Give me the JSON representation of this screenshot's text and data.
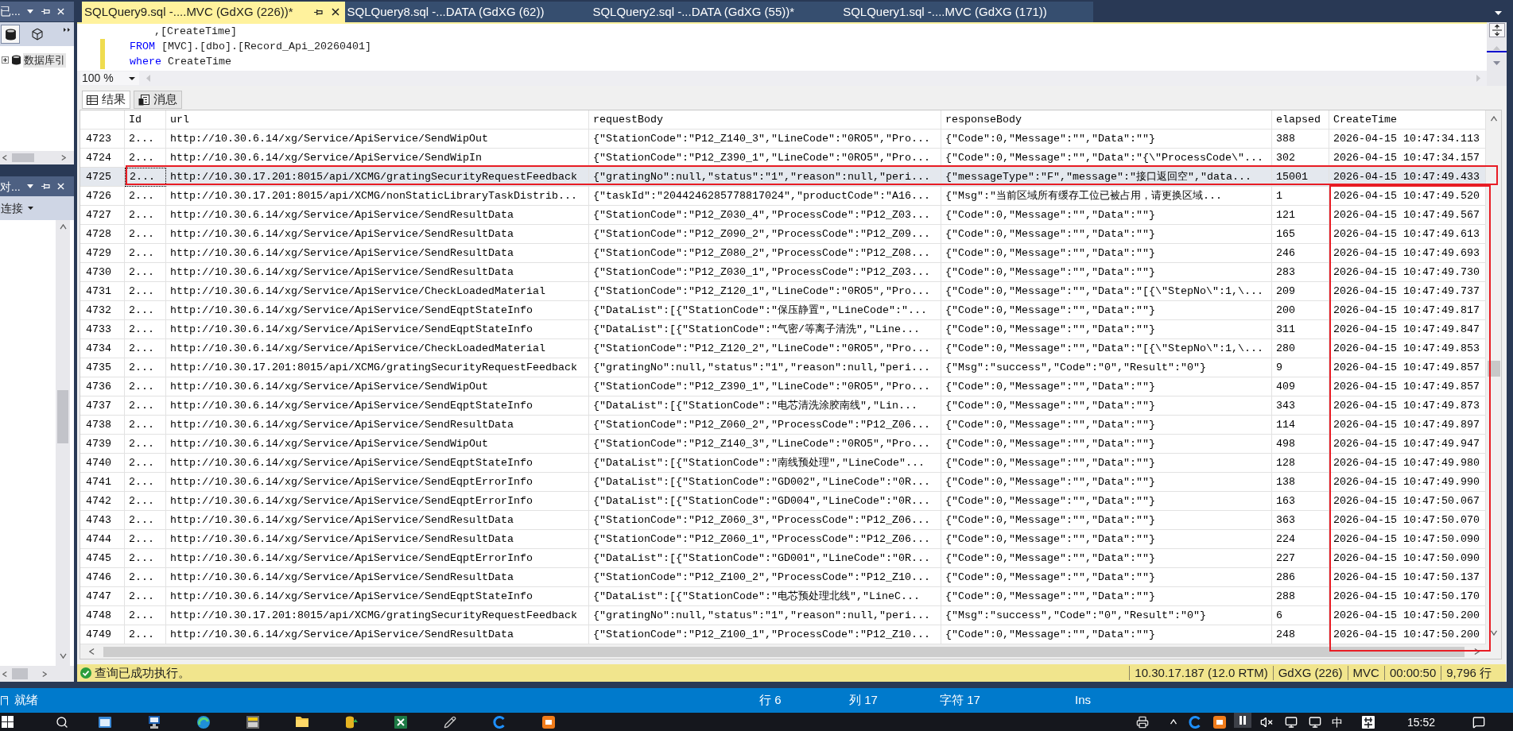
{
  "registered_servers": {
    "title": "已...",
    "toolbar": [
      {
        "kind": "database",
        "selected": true
      },
      {
        "kind": "cube",
        "selected": false
      }
    ],
    "items": [
      {
        "label": "数据库引",
        "expanded": false,
        "selected": true
      }
    ]
  },
  "object_explorer": {
    "title": "对...",
    "connect_label": "连接"
  },
  "document_tabs": [
    {
      "label": "SQLQuery9.sql -....MVC (GdXG (226))*",
      "selected": true
    },
    {
      "label": "SQLQuery8.sql -...DATA (GdXG (62))",
      "selected": false
    },
    {
      "label": "SQLQuery2.sql -...DATA (GdXG (55))*",
      "selected": false
    },
    {
      "label": "SQLQuery1.sql -....MVC (GdXG (171))",
      "selected": false
    }
  ],
  "editor": {
    "lines": [
      {
        "kind": "column",
        "modified": false,
        "tokens": [
          {
            "kind": "plain",
            "text": ",[CreateTime]"
          }
        ]
      },
      {
        "kind": "clause",
        "modified": true,
        "tokens": [
          {
            "kind": "keyword",
            "text": "FROM"
          },
          {
            "kind": "plain",
            "text": "[MVC].[dbo].[Record_Api_20260401]"
          }
        ]
      },
      {
        "kind": "clause",
        "modified": true,
        "tokens": [
          {
            "kind": "keyword",
            "text": "where"
          },
          {
            "kind": "plain",
            "text": "CreateTime"
          }
        ]
      }
    ]
  },
  "zoom": {
    "value": "100 %"
  },
  "result_tabs": [
    {
      "kind": "grid",
      "label": "结果",
      "selected": true
    },
    {
      "kind": "messages",
      "label": "消息",
      "selected": false
    }
  ],
  "grid": {
    "columns": [
      "Id",
      "url",
      "requestBody",
      "responseBody",
      "elapsed",
      "CreateTime"
    ],
    "rows": [
      {
        "number": "4723",
        "selected": false,
        "cells": [
          "2...",
          "http://10.30.6.14/xg/Service/ApiService/SendWipOut",
          "{\"StationCode\":\"P12_Z140_3\",\"LineCode\":\"0RO5\",\"Pro...",
          "{\"Code\":0,\"Message\":\"\",\"Data\":\"\"}",
          "388",
          "2026-04-15 10:47:34.113"
        ]
      },
      {
        "number": "4724",
        "selected": false,
        "cells": [
          "2...",
          "http://10.30.6.14/xg/Service/ApiService/SendWipIn",
          "{\"StationCode\":\"P12_Z390_1\",\"LineCode\":\"0RO5\",\"Pro...",
          "{\"Code\":0,\"Message\":\"\",\"Data\":\"{\\\"ProcessCode\\\"...",
          "302",
          "2026-04-15 10:47:34.157"
        ]
      },
      {
        "number": "4725",
        "selected": true,
        "cells": [
          "2...",
          "http://10.30.17.201:8015/api/XCMG/gratingSecurityRequestFeedback",
          "{\"gratingNo\":null,\"status\":\"1\",\"reason\":null,\"peri...",
          "{\"messageType\":\"F\",\"message\":\"接口返回空\",\"data...",
          "15001",
          "2026-04-15 10:47:49.433"
        ]
      },
      {
        "number": "4726",
        "selected": false,
        "cells": [
          "2...",
          "http://10.30.17.201:8015/api/XCMG/nonStaticLibraryTaskDistrib...",
          "{\"taskId\":\"2044246285778817024\",\"productCode\":\"A16...",
          "{\"Msg\":\"当前区域所有缓存工位已被占用，请更换区域...",
          "1",
          "2026-04-15 10:47:49.520"
        ]
      },
      {
        "number": "4727",
        "selected": false,
        "cells": [
          "2...",
          "http://10.30.6.14/xg/Service/ApiService/SendResultData",
          "{\"StationCode\":\"P12_Z030_4\",\"ProcessCode\":\"P12_Z03...",
          "{\"Code\":0,\"Message\":\"\",\"Data\":\"\"}",
          "121",
          "2026-04-15 10:47:49.567"
        ]
      },
      {
        "number": "4728",
        "selected": false,
        "cells": [
          "2...",
          "http://10.30.6.14/xg/Service/ApiService/SendResultData",
          "{\"StationCode\":\"P12_Z090_2\",\"ProcessCode\":\"P12_Z09...",
          "{\"Code\":0,\"Message\":\"\",\"Data\":\"\"}",
          "165",
          "2026-04-15 10:47:49.613"
        ]
      },
      {
        "number": "4729",
        "selected": false,
        "cells": [
          "2...",
          "http://10.30.6.14/xg/Service/ApiService/SendResultData",
          "{\"StationCode\":\"P12_Z080_2\",\"ProcessCode\":\"P12_Z08...",
          "{\"Code\":0,\"Message\":\"\",\"Data\":\"\"}",
          "246",
          "2026-04-15 10:47:49.693"
        ]
      },
      {
        "number": "4730",
        "selected": false,
        "cells": [
          "2...",
          "http://10.30.6.14/xg/Service/ApiService/SendResultData",
          "{\"StationCode\":\"P12_Z030_1\",\"ProcessCode\":\"P12_Z03...",
          "{\"Code\":0,\"Message\":\"\",\"Data\":\"\"}",
          "283",
          "2026-04-15 10:47:49.730"
        ]
      },
      {
        "number": "4731",
        "selected": false,
        "cells": [
          "2...",
          "http://10.30.6.14/xg/Service/ApiService/CheckLoadedMaterial",
          "{\"StationCode\":\"P12_Z120_1\",\"LineCode\":\"0RO5\",\"Pro...",
          "{\"Code\":0,\"Message\":\"\",\"Data\":\"[{\\\"StepNo\\\":1,\\...",
          "209",
          "2026-04-15 10:47:49.737"
        ]
      },
      {
        "number": "4732",
        "selected": false,
        "cells": [
          "2...",
          "http://10.30.6.14/xg/Service/ApiService/SendEqptStateInfo",
          "{\"DataList\":[{\"StationCode\":\"保压静置\",\"LineCode\":\"...",
          "{\"Code\":0,\"Message\":\"\",\"Data\":\"\"}",
          "200",
          "2026-04-15 10:47:49.817"
        ]
      },
      {
        "number": "4733",
        "selected": false,
        "cells": [
          "2...",
          "http://10.30.6.14/xg/Service/ApiService/SendEqptStateInfo",
          "{\"DataList\":[{\"StationCode\":\"气密/等离子清洗\",\"Line...",
          "{\"Code\":0,\"Message\":\"\",\"Data\":\"\"}",
          "311",
          "2026-04-15 10:47:49.847"
        ]
      },
      {
        "number": "4734",
        "selected": false,
        "cells": [
          "2...",
          "http://10.30.6.14/xg/Service/ApiService/CheckLoadedMaterial",
          "{\"StationCode\":\"P12_Z120_2\",\"LineCode\":\"0RO5\",\"Pro...",
          "{\"Code\":0,\"Message\":\"\",\"Data\":\"[{\\\"StepNo\\\":1,\\...",
          "280",
          "2026-04-15 10:47:49.853"
        ]
      },
      {
        "number": "4735",
        "selected": false,
        "cells": [
          "2...",
          "http://10.30.17.201:8015/api/XCMG/gratingSecurityRequestFeedback",
          "{\"gratingNo\":null,\"status\":\"1\",\"reason\":null,\"peri...",
          "{\"Msg\":\"success\",\"Code\":\"0\",\"Result\":\"0\"}",
          "9",
          "2026-04-15 10:47:49.857"
        ]
      },
      {
        "number": "4736",
        "selected": false,
        "cells": [
          "2...",
          "http://10.30.6.14/xg/Service/ApiService/SendWipOut",
          "{\"StationCode\":\"P12_Z390_1\",\"LineCode\":\"0RO5\",\"Pro...",
          "{\"Code\":0,\"Message\":\"\",\"Data\":\"\"}",
          "409",
          "2026-04-15 10:47:49.857"
        ]
      },
      {
        "number": "4737",
        "selected": false,
        "cells": [
          "2...",
          "http://10.30.6.14/xg/Service/ApiService/SendEqptStateInfo",
          "{\"DataList\":[{\"StationCode\":\"电芯清洗涂胶南线\",\"Lin...",
          "{\"Code\":0,\"Message\":\"\",\"Data\":\"\"}",
          "343",
          "2026-04-15 10:47:49.873"
        ]
      },
      {
        "number": "4738",
        "selected": false,
        "cells": [
          "2...",
          "http://10.30.6.14/xg/Service/ApiService/SendResultData",
          "{\"StationCode\":\"P12_Z060_2\",\"ProcessCode\":\"P12_Z06...",
          "{\"Code\":0,\"Message\":\"\",\"Data\":\"\"}",
          "114",
          "2026-04-15 10:47:49.897"
        ]
      },
      {
        "number": "4739",
        "selected": false,
        "cells": [
          "2...",
          "http://10.30.6.14/xg/Service/ApiService/SendWipOut",
          "{\"StationCode\":\"P12_Z140_3\",\"LineCode\":\"0RO5\",\"Pro...",
          "{\"Code\":0,\"Message\":\"\",\"Data\":\"\"}",
          "498",
          "2026-04-15 10:47:49.947"
        ]
      },
      {
        "number": "4740",
        "selected": false,
        "cells": [
          "2...",
          "http://10.30.6.14/xg/Service/ApiService/SendEqptStateInfo",
          "{\"DataList\":[{\"StationCode\":\"南线预处理\",\"LineCode\"...",
          "{\"Code\":0,\"Message\":\"\",\"Data\":\"\"}",
          "128",
          "2026-04-15 10:47:49.980"
        ]
      },
      {
        "number": "4741",
        "selected": false,
        "cells": [
          "2...",
          "http://10.30.6.14/xg/Service/ApiService/SendEqptErrorInfo",
          "{\"DataList\":[{\"StationCode\":\"GD002\",\"LineCode\":\"0R...",
          "{\"Code\":0,\"Message\":\"\",\"Data\":\"\"}",
          "138",
          "2026-04-15 10:47:49.990"
        ]
      },
      {
        "number": "4742",
        "selected": false,
        "cells": [
          "2...",
          "http://10.30.6.14/xg/Service/ApiService/SendEqptErrorInfo",
          "{\"DataList\":[{\"StationCode\":\"GD004\",\"LineCode\":\"0R...",
          "{\"Code\":0,\"Message\":\"\",\"Data\":\"\"}",
          "163",
          "2026-04-15 10:47:50.067"
        ]
      },
      {
        "number": "4743",
        "selected": false,
        "cells": [
          "2...",
          "http://10.30.6.14/xg/Service/ApiService/SendResultData",
          "{\"StationCode\":\"P12_Z060_3\",\"ProcessCode\":\"P12_Z06...",
          "{\"Code\":0,\"Message\":\"\",\"Data\":\"\"}",
          "363",
          "2026-04-15 10:47:50.070"
        ]
      },
      {
        "number": "4744",
        "selected": false,
        "cells": [
          "2...",
          "http://10.30.6.14/xg/Service/ApiService/SendResultData",
          "{\"StationCode\":\"P12_Z060_1\",\"ProcessCode\":\"P12_Z06...",
          "{\"Code\":0,\"Message\":\"\",\"Data\":\"\"}",
          "224",
          "2026-04-15 10:47:50.090"
        ]
      },
      {
        "number": "4745",
        "selected": false,
        "cells": [
          "2...",
          "http://10.30.6.14/xg/Service/ApiService/SendEqptErrorInfo",
          "{\"DataList\":[{\"StationCode\":\"GD001\",\"LineCode\":\"0R...",
          "{\"Code\":0,\"Message\":\"\",\"Data\":\"\"}",
          "227",
          "2026-04-15 10:47:50.090"
        ]
      },
      {
        "number": "4746",
        "selected": false,
        "cells": [
          "2...",
          "http://10.30.6.14/xg/Service/ApiService/SendResultData",
          "{\"StationCode\":\"P12_Z100_2\",\"ProcessCode\":\"P12_Z10...",
          "{\"Code\":0,\"Message\":\"\",\"Data\":\"\"}",
          "286",
          "2026-04-15 10:47:50.137"
        ]
      },
      {
        "number": "4747",
        "selected": false,
        "cells": [
          "2...",
          "http://10.30.6.14/xg/Service/ApiService/SendEqptStateInfo",
          "{\"DataList\":[{\"StationCode\":\"电芯预处理北线\",\"LineC...",
          "{\"Code\":0,\"Message\":\"\",\"Data\":\"\"}",
          "288",
          "2026-04-15 10:47:50.170"
        ]
      },
      {
        "number": "4748",
        "selected": false,
        "cells": [
          "2...",
          "http://10.30.17.201:8015/api/XCMG/gratingSecurityRequestFeedback",
          "{\"gratingNo\":null,\"status\":\"1\",\"reason\":null,\"peri...",
          "{\"Msg\":\"success\",\"Code\":\"0\",\"Result\":\"0\"}",
          "6",
          "2026-04-15 10:47:50.200"
        ]
      },
      {
        "number": "4749",
        "selected": false,
        "cells": [
          "2...",
          "http://10.30.6.14/xg/Service/ApiService/SendResultData",
          "{\"StationCode\":\"P12_Z100_1\",\"ProcessCode\":\"P12_Z10...",
          "{\"Code\":0,\"Message\":\"\",\"Data\":\"\"}",
          "248",
          "2026-04-15 10:47:50.200"
        ]
      }
    ]
  },
  "query_status": {
    "kind": "success",
    "message": "查询已成功执行。",
    "segments": [
      "10.30.17.187 (12.0 RTM)",
      "GdXG (226)",
      "MVC",
      "00:00:50",
      "9,796 行"
    ]
  },
  "status_bar": {
    "message": "就绪",
    "items": [
      "行 6",
      "列 17",
      "字符 17",
      "Ins"
    ]
  },
  "taskbar": {
    "ime": "中",
    "clock": "15:52"
  }
}
